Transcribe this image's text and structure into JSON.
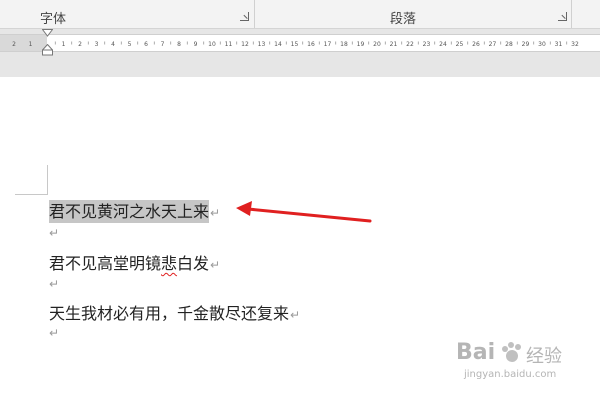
{
  "ribbon": {
    "font_group": "字体",
    "paragraph_group": "段落"
  },
  "ruler": {
    "left_ticks": [
      "2",
      "1"
    ],
    "ticks": [
      "1",
      "2",
      "3",
      "4",
      "5",
      "6",
      "7",
      "8",
      "9",
      "10",
      "11",
      "12",
      "13",
      "14",
      "15",
      "16",
      "17",
      "18",
      "19",
      "20",
      "21",
      "22",
      "23",
      "24",
      "25",
      "26",
      "27",
      "28",
      "29",
      "30",
      "31",
      "32"
    ]
  },
  "document": {
    "line1": "君不见黄河之水天上来",
    "line2": "君不见高堂明镜悲白发",
    "line3": "天生我材必有用，千金散尽还复来",
    "paragraph_mark": "↵",
    "empty_mark": "↵"
  },
  "watermark": {
    "brand": "Bai",
    "brand_tail": "经验",
    "url": "jingyan.baidu.com"
  },
  "colors": {
    "selection": "#c6c6c6",
    "arrow": "#e02020",
    "ruler_bg": "#e6e6e6"
  }
}
